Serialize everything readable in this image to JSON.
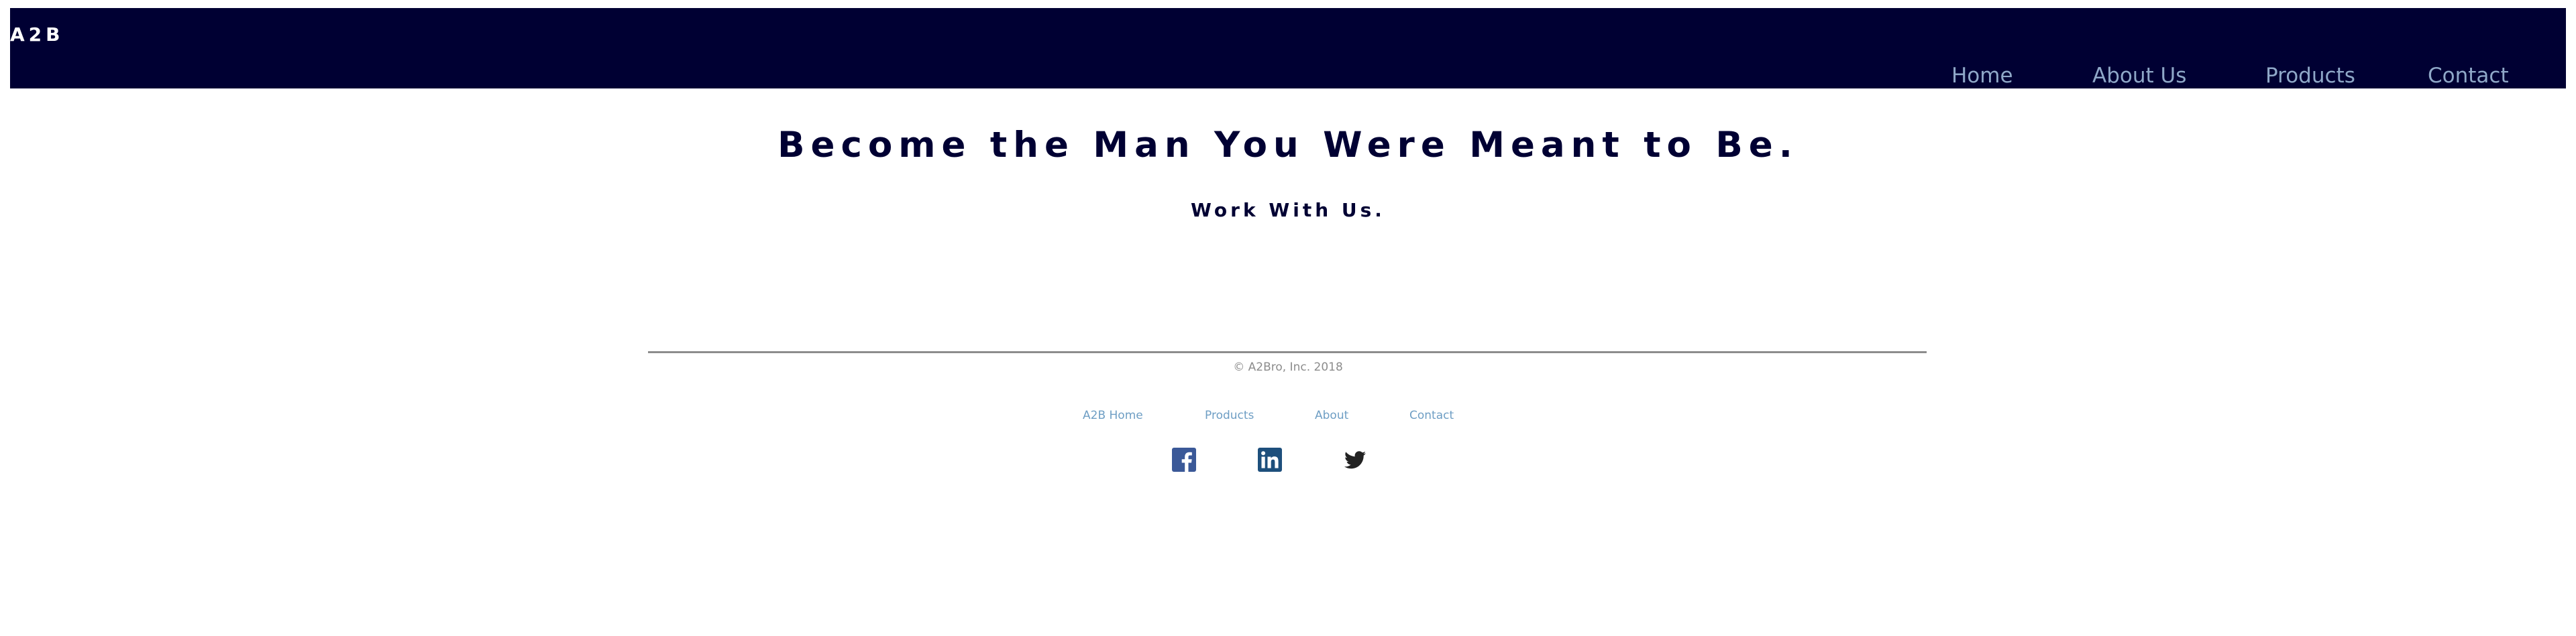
{
  "header": {
    "logo": "A2B",
    "nav": [
      {
        "label": "Home"
      },
      {
        "label": "About Us"
      },
      {
        "label": "Products"
      },
      {
        "label": "Contact"
      }
    ]
  },
  "main": {
    "headline": "Become the Man You Were Meant to Be.",
    "subheadline": "Work With Us."
  },
  "footer": {
    "copyright": "© A2Bro, Inc. 2018",
    "links": [
      {
        "label": "A2B Home"
      },
      {
        "label": "Products"
      },
      {
        "label": "About"
      },
      {
        "label": "Contact"
      }
    ],
    "social": [
      {
        "icon": "facebook-icon",
        "color": "#3b5998"
      },
      {
        "icon": "linkedin-icon",
        "color": "#1d4f7c"
      },
      {
        "icon": "twitter-icon",
        "color": "#222222"
      }
    ]
  },
  "colors": {
    "header_bg": "#000033",
    "nav_link": "#8fa8c8",
    "heading": "#000033",
    "footer_link": "#6e9ec4",
    "muted": "#8c8c8c"
  }
}
